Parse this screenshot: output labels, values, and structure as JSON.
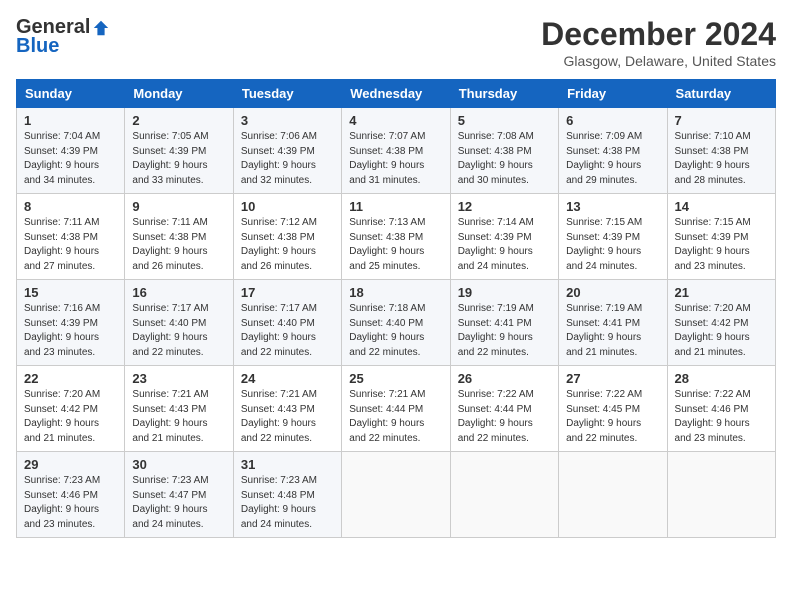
{
  "logo": {
    "general": "General",
    "blue": "Blue"
  },
  "title": "December 2024",
  "location": "Glasgow, Delaware, United States",
  "days_header": [
    "Sunday",
    "Monday",
    "Tuesday",
    "Wednesday",
    "Thursday",
    "Friday",
    "Saturday"
  ],
  "weeks": [
    [
      {
        "day": "1",
        "sunrise": "Sunrise: 7:04 AM",
        "sunset": "Sunset: 4:39 PM",
        "daylight": "Daylight: 9 hours and 34 minutes."
      },
      {
        "day": "2",
        "sunrise": "Sunrise: 7:05 AM",
        "sunset": "Sunset: 4:39 PM",
        "daylight": "Daylight: 9 hours and 33 minutes."
      },
      {
        "day": "3",
        "sunrise": "Sunrise: 7:06 AM",
        "sunset": "Sunset: 4:39 PM",
        "daylight": "Daylight: 9 hours and 32 minutes."
      },
      {
        "day": "4",
        "sunrise": "Sunrise: 7:07 AM",
        "sunset": "Sunset: 4:38 PM",
        "daylight": "Daylight: 9 hours and 31 minutes."
      },
      {
        "day": "5",
        "sunrise": "Sunrise: 7:08 AM",
        "sunset": "Sunset: 4:38 PM",
        "daylight": "Daylight: 9 hours and 30 minutes."
      },
      {
        "day": "6",
        "sunrise": "Sunrise: 7:09 AM",
        "sunset": "Sunset: 4:38 PM",
        "daylight": "Daylight: 9 hours and 29 minutes."
      },
      {
        "day": "7",
        "sunrise": "Sunrise: 7:10 AM",
        "sunset": "Sunset: 4:38 PM",
        "daylight": "Daylight: 9 hours and 28 minutes."
      }
    ],
    [
      {
        "day": "8",
        "sunrise": "Sunrise: 7:11 AM",
        "sunset": "Sunset: 4:38 PM",
        "daylight": "Daylight: 9 hours and 27 minutes."
      },
      {
        "day": "9",
        "sunrise": "Sunrise: 7:11 AM",
        "sunset": "Sunset: 4:38 PM",
        "daylight": "Daylight: 9 hours and 26 minutes."
      },
      {
        "day": "10",
        "sunrise": "Sunrise: 7:12 AM",
        "sunset": "Sunset: 4:38 PM",
        "daylight": "Daylight: 9 hours and 26 minutes."
      },
      {
        "day": "11",
        "sunrise": "Sunrise: 7:13 AM",
        "sunset": "Sunset: 4:38 PM",
        "daylight": "Daylight: 9 hours and 25 minutes."
      },
      {
        "day": "12",
        "sunrise": "Sunrise: 7:14 AM",
        "sunset": "Sunset: 4:39 PM",
        "daylight": "Daylight: 9 hours and 24 minutes."
      },
      {
        "day": "13",
        "sunrise": "Sunrise: 7:15 AM",
        "sunset": "Sunset: 4:39 PM",
        "daylight": "Daylight: 9 hours and 24 minutes."
      },
      {
        "day": "14",
        "sunrise": "Sunrise: 7:15 AM",
        "sunset": "Sunset: 4:39 PM",
        "daylight": "Daylight: 9 hours and 23 minutes."
      }
    ],
    [
      {
        "day": "15",
        "sunrise": "Sunrise: 7:16 AM",
        "sunset": "Sunset: 4:39 PM",
        "daylight": "Daylight: 9 hours and 23 minutes."
      },
      {
        "day": "16",
        "sunrise": "Sunrise: 7:17 AM",
        "sunset": "Sunset: 4:40 PM",
        "daylight": "Daylight: 9 hours and 22 minutes."
      },
      {
        "day": "17",
        "sunrise": "Sunrise: 7:17 AM",
        "sunset": "Sunset: 4:40 PM",
        "daylight": "Daylight: 9 hours and 22 minutes."
      },
      {
        "day": "18",
        "sunrise": "Sunrise: 7:18 AM",
        "sunset": "Sunset: 4:40 PM",
        "daylight": "Daylight: 9 hours and 22 minutes."
      },
      {
        "day": "19",
        "sunrise": "Sunrise: 7:19 AM",
        "sunset": "Sunset: 4:41 PM",
        "daylight": "Daylight: 9 hours and 22 minutes."
      },
      {
        "day": "20",
        "sunrise": "Sunrise: 7:19 AM",
        "sunset": "Sunset: 4:41 PM",
        "daylight": "Daylight: 9 hours and 21 minutes."
      },
      {
        "day": "21",
        "sunrise": "Sunrise: 7:20 AM",
        "sunset": "Sunset: 4:42 PM",
        "daylight": "Daylight: 9 hours and 21 minutes."
      }
    ],
    [
      {
        "day": "22",
        "sunrise": "Sunrise: 7:20 AM",
        "sunset": "Sunset: 4:42 PM",
        "daylight": "Daylight: 9 hours and 21 minutes."
      },
      {
        "day": "23",
        "sunrise": "Sunrise: 7:21 AM",
        "sunset": "Sunset: 4:43 PM",
        "daylight": "Daylight: 9 hours and 21 minutes."
      },
      {
        "day": "24",
        "sunrise": "Sunrise: 7:21 AM",
        "sunset": "Sunset: 4:43 PM",
        "daylight": "Daylight: 9 hours and 22 minutes."
      },
      {
        "day": "25",
        "sunrise": "Sunrise: 7:21 AM",
        "sunset": "Sunset: 4:44 PM",
        "daylight": "Daylight: 9 hours and 22 minutes."
      },
      {
        "day": "26",
        "sunrise": "Sunrise: 7:22 AM",
        "sunset": "Sunset: 4:44 PM",
        "daylight": "Daylight: 9 hours and 22 minutes."
      },
      {
        "day": "27",
        "sunrise": "Sunrise: 7:22 AM",
        "sunset": "Sunset: 4:45 PM",
        "daylight": "Daylight: 9 hours and 22 minutes."
      },
      {
        "day": "28",
        "sunrise": "Sunrise: 7:22 AM",
        "sunset": "Sunset: 4:46 PM",
        "daylight": "Daylight: 9 hours and 23 minutes."
      }
    ],
    [
      {
        "day": "29",
        "sunrise": "Sunrise: 7:23 AM",
        "sunset": "Sunset: 4:46 PM",
        "daylight": "Daylight: 9 hours and 23 minutes."
      },
      {
        "day": "30",
        "sunrise": "Sunrise: 7:23 AM",
        "sunset": "Sunset: 4:47 PM",
        "daylight": "Daylight: 9 hours and 24 minutes."
      },
      {
        "day": "31",
        "sunrise": "Sunrise: 7:23 AM",
        "sunset": "Sunset: 4:48 PM",
        "daylight": "Daylight: 9 hours and 24 minutes."
      },
      null,
      null,
      null,
      null
    ]
  ]
}
